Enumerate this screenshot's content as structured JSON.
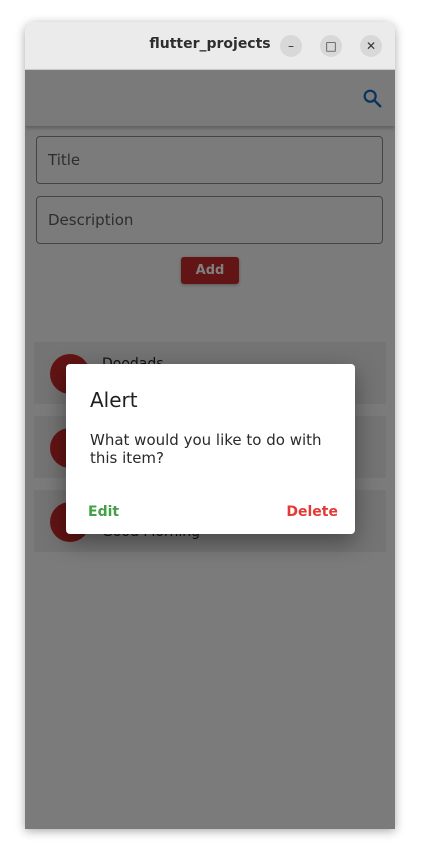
{
  "window": {
    "title": "flutter_projects",
    "minimize_glyph": "–",
    "maximize_glyph": "□",
    "close_glyph": "✕"
  },
  "appbar": {
    "search_icon": "search-icon",
    "accent": "#1565c0"
  },
  "form": {
    "title_placeholder": "Title",
    "description_placeholder": "Description",
    "add_label": "Add",
    "add_color": "#c62828"
  },
  "items": [
    {
      "title": "Doodads",
      "subtitle": ""
    },
    {
      "title": "",
      "subtitle": ""
    },
    {
      "title": "",
      "subtitle": "Good Morning"
    }
  ],
  "dialog": {
    "title": "Alert",
    "message": "What would you like to do with this item?",
    "edit_label": "Edit",
    "delete_label": "Delete",
    "edit_color": "#43a047",
    "delete_color": "#e53935"
  }
}
